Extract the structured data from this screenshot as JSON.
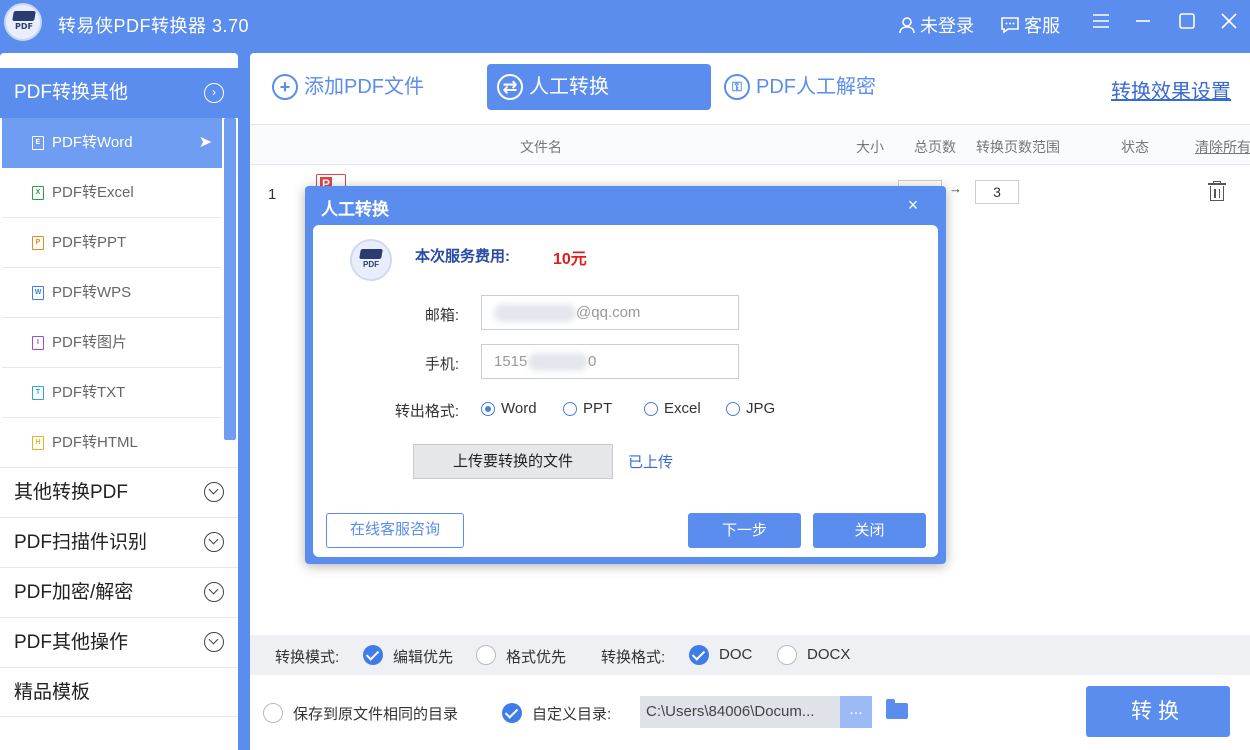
{
  "app": {
    "title": "转易侠PDF转换器 3.70",
    "login": "未登录",
    "service": "客服"
  },
  "sidebar": {
    "group_title": "PDF转换其他",
    "sub_items": [
      {
        "label": "PDF转Word",
        "icon": "word-file-icon",
        "active": true
      },
      {
        "label": "PDF转Excel",
        "icon": "excel-file-icon"
      },
      {
        "label": "PDF转PPT",
        "icon": "ppt-file-icon"
      },
      {
        "label": "PDF转WPS",
        "icon": "wps-file-icon"
      },
      {
        "label": "PDF转图片",
        "icon": "image-file-icon"
      },
      {
        "label": "PDF转TXT",
        "icon": "txt-file-icon"
      },
      {
        "label": "PDF转HTML",
        "icon": "html-file-icon"
      }
    ],
    "main_items": [
      {
        "label": "其他转换PDF"
      },
      {
        "label": "PDF扫描件识别"
      },
      {
        "label": "PDF加密/解密"
      },
      {
        "label": "PDF其他操作"
      },
      {
        "label": "精品模板"
      }
    ]
  },
  "toolbar": {
    "add_pdf": "添加PDF文件",
    "manual_convert": "人工转换",
    "manual_decrypt": "PDF人工解密",
    "settings_link": "转换效果设置"
  },
  "table": {
    "headers": {
      "filename": "文件名",
      "size": "大小",
      "pages": "总页数",
      "range": "转换页数范围",
      "status": "状态",
      "clear": "清除所有"
    },
    "rows": [
      {
        "index": "1",
        "range_arrow": "→",
        "range_to": "3"
      }
    ]
  },
  "options": {
    "mode_label": "转换模式:",
    "mode_edit": "编辑优先",
    "mode_format": "格式优先",
    "format_label": "转换格式:",
    "format_doc": "DOC",
    "format_docx": "DOCX"
  },
  "output": {
    "same_dir": "保存到原文件相同的目录",
    "custom_dir": "自定义目录:",
    "path": "C:\\Users\\84006\\Docum...",
    "browse": "...",
    "convert": "转换"
  },
  "dialog": {
    "title": "人工转换",
    "close_x": "×",
    "fee_label": "本次服务费用:",
    "fee_value": "10元",
    "email_label": "邮箱:",
    "email_value": "@qq.com",
    "phone_label": "手机:",
    "phone_value_start": "1515",
    "phone_value_end": "0",
    "format_label": "转出格式:",
    "formats": [
      "Word",
      "PPT",
      "Excel",
      "JPG"
    ],
    "selected_format": "Word",
    "upload_button": "上传要转换的文件",
    "upload_status": "已上传",
    "consult_button": "在线客服咨询",
    "next_button": "下一步",
    "close_button": "关闭"
  },
  "colors": {
    "accent": "#5b8def",
    "price": "#e01b1b",
    "fee_label": "#2a4ba3"
  }
}
